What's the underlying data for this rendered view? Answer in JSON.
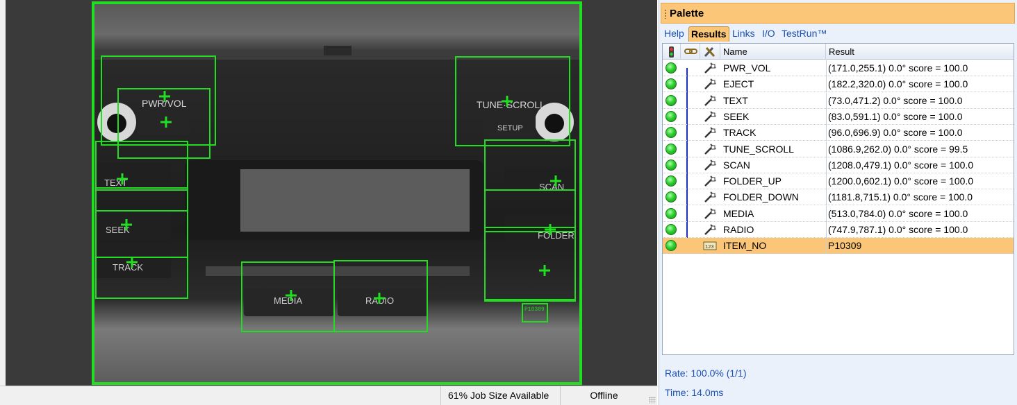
{
  "status_bar": {
    "job_size": "61% Job Size Available",
    "connection": "Offline"
  },
  "palette": {
    "title": "Palette",
    "tabs": [
      {
        "label": "Help",
        "active": false
      },
      {
        "label": "Results",
        "active": true
      },
      {
        "label": "Links",
        "active": false
      },
      {
        "label": "I/O",
        "active": false
      },
      {
        "label": "TestRun™",
        "active": false
      }
    ],
    "columns": {
      "status_icon": "status-light-icon",
      "link_icon": "link-chain-icon",
      "tool_icon": "tools-icon",
      "name": "Name",
      "result": "Result"
    },
    "rows": [
      {
        "name": "PWR_VOL",
        "result": "(171.0,255.1) 0.0° score = 100.0",
        "icon": "pattern-tool-icon",
        "selected": false
      },
      {
        "name": "EJECT",
        "result": "(182.2,320.0) 0.0° score = 100.0",
        "icon": "pattern-tool-icon",
        "selected": false
      },
      {
        "name": "TEXT",
        "result": "(73.0,471.2) 0.0° score = 100.0",
        "icon": "pattern-tool-icon",
        "selected": false
      },
      {
        "name": "SEEK",
        "result": "(83.0,591.1) 0.0° score = 100.0",
        "icon": "pattern-tool-icon",
        "selected": false
      },
      {
        "name": "TRACK",
        "result": "(96.0,696.9) 0.0° score = 100.0",
        "icon": "pattern-tool-icon",
        "selected": false
      },
      {
        "name": "TUNE_SCROLL",
        "result": "(1086.9,262.0) 0.0° score = 99.5",
        "icon": "pattern-tool-icon",
        "selected": false
      },
      {
        "name": "SCAN",
        "result": "(1208.0,479.1) 0.0° score = 100.0",
        "icon": "pattern-tool-icon",
        "selected": false
      },
      {
        "name": "FOLDER_UP",
        "result": "(1200.0,602.1) 0.0° score = 100.0",
        "icon": "pattern-tool-icon",
        "selected": false
      },
      {
        "name": "FOLDER_DOWN",
        "result": "(1181.8,715.1) 0.0° score = 100.0",
        "icon": "pattern-tool-icon",
        "selected": false
      },
      {
        "name": "MEDIA",
        "result": "(513.0,784.0) 0.0° score = 100.0",
        "icon": "pattern-tool-icon",
        "selected": false
      },
      {
        "name": "RADIO",
        "result": "(747.9,787.1) 0.0° score = 100.0",
        "icon": "pattern-tool-icon",
        "selected": false
      },
      {
        "name": "ITEM_NO",
        "result": "P10309",
        "icon": "ocr-tool-icon",
        "selected": true
      }
    ],
    "rate": "Rate: 100.0% (1/1)",
    "time": "Time: 14.0ms"
  },
  "image_labels": {
    "pwr_vol": "PWR/VOL",
    "tune_scroll": "TUNE·SCROLL",
    "setup": "SETUP",
    "text": "TEXT",
    "seek": "SEEK",
    "track": "TRACK",
    "scan": "SCAN",
    "folder": "FOLDER",
    "media": "MEDIA",
    "radio": "RADIO",
    "item_no": "P10309"
  },
  "colors": {
    "overlay_green": "#22dd22",
    "palette_accent": "#fbc677",
    "status_ok": "#2fd12f",
    "link_blue": "#1c2fc0"
  }
}
